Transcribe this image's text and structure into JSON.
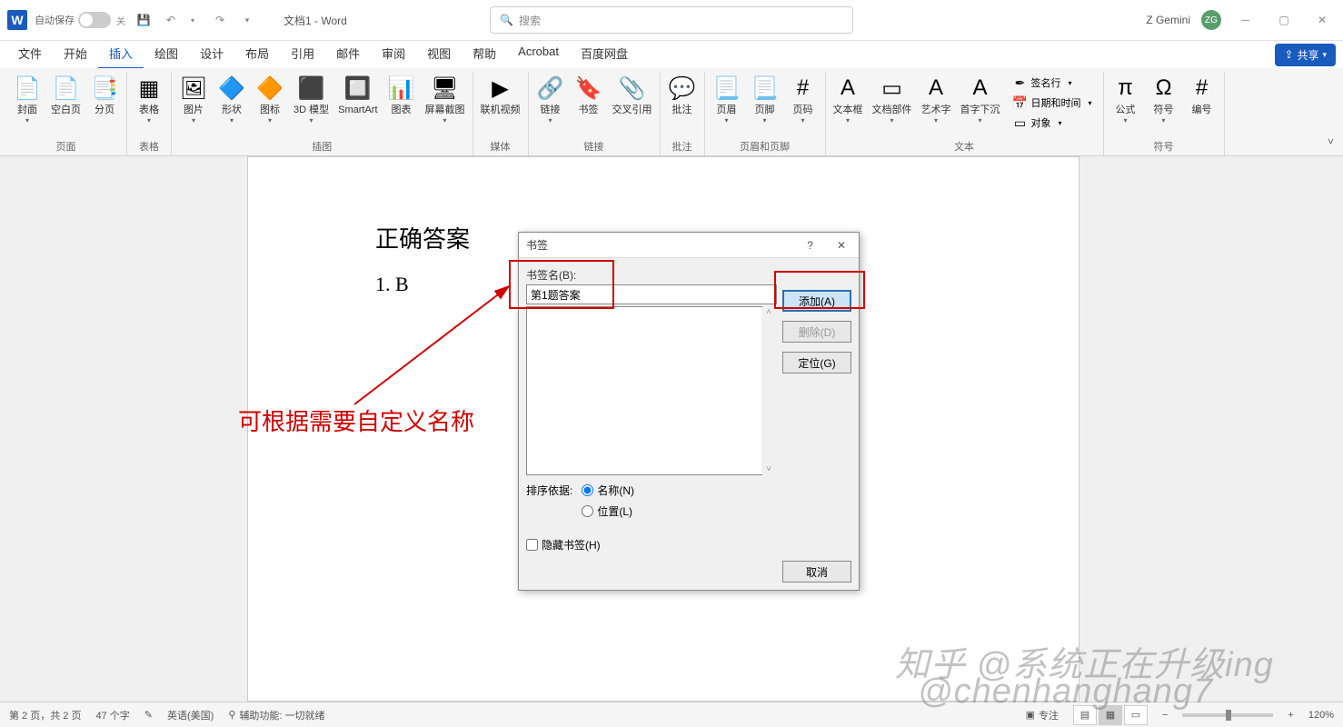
{
  "titlebar": {
    "autosave_label": "自动保存",
    "autosave_state": "关",
    "doc_title": "文档1 - Word",
    "search_placeholder": "搜索",
    "user_name": "Z Gemini",
    "user_initials": "ZG"
  },
  "tabs": {
    "items": [
      "文件",
      "开始",
      "插入",
      "绘图",
      "设计",
      "布局",
      "引用",
      "邮件",
      "审阅",
      "视图",
      "帮助",
      "Acrobat",
      "百度网盘"
    ],
    "active_index": 2,
    "share_label": "共享"
  },
  "ribbon": {
    "groups": [
      {
        "label": "页面",
        "items": [
          {
            "label": "封面",
            "icon": "📄",
            "caret": true
          },
          {
            "label": "空白页",
            "icon": "📄"
          },
          {
            "label": "分页",
            "icon": "📑"
          }
        ]
      },
      {
        "label": "表格",
        "items": [
          {
            "label": "表格",
            "icon": "▦",
            "caret": true
          }
        ]
      },
      {
        "label": "插图",
        "items": [
          {
            "label": "图片",
            "icon": "🖼",
            "caret": true
          },
          {
            "label": "形状",
            "icon": "🔷",
            "caret": true
          },
          {
            "label": "图标",
            "icon": "🔶",
            "caret": true
          },
          {
            "label": "3D 模型",
            "icon": "⬛",
            "caret": true
          },
          {
            "label": "SmartArt",
            "icon": "🔲"
          },
          {
            "label": "图表",
            "icon": "📊"
          },
          {
            "label": "屏幕截图",
            "icon": "🖥",
            "caret": true
          }
        ]
      },
      {
        "label": "媒体",
        "items": [
          {
            "label": "联机视频",
            "icon": "▶"
          }
        ]
      },
      {
        "label": "链接",
        "items": [
          {
            "label": "链接",
            "icon": "🔗",
            "caret": true
          },
          {
            "label": "书签",
            "icon": "🔖"
          },
          {
            "label": "交叉引用",
            "icon": "📎"
          }
        ]
      },
      {
        "label": "批注",
        "items": [
          {
            "label": "批注",
            "icon": "💬"
          }
        ]
      },
      {
        "label": "页眉和页脚",
        "items": [
          {
            "label": "页眉",
            "icon": "📃",
            "caret": true
          },
          {
            "label": "页脚",
            "icon": "📃",
            "caret": true
          },
          {
            "label": "页码",
            "icon": "#",
            "caret": true
          }
        ]
      },
      {
        "label": "文本",
        "items": [
          {
            "label": "文本框",
            "icon": "A",
            "caret": true
          },
          {
            "label": "文档部件",
            "icon": "▭",
            "caret": true
          },
          {
            "label": "艺术字",
            "icon": "A",
            "caret": true
          },
          {
            "label": "首字下沉",
            "icon": "A",
            "caret": true
          }
        ],
        "small": [
          {
            "label": "签名行",
            "icon": "✒"
          },
          {
            "label": "日期和时间",
            "icon": "📅"
          },
          {
            "label": "对象",
            "icon": "▭"
          }
        ]
      },
      {
        "label": "符号",
        "items": [
          {
            "label": "公式",
            "icon": "π",
            "caret": true
          },
          {
            "label": "符号",
            "icon": "Ω",
            "caret": true
          },
          {
            "label": "编号",
            "icon": "#"
          }
        ]
      }
    ]
  },
  "document": {
    "heading": "正确答案",
    "line1": "1. B"
  },
  "annotation": {
    "text": "可根据需要自定义名称"
  },
  "dialog": {
    "title": "书签",
    "name_label": "书签名(B):",
    "name_value": "第1题答案",
    "add_label": "添加(A)",
    "delete_label": "删除(D)",
    "goto_label": "定位(G)",
    "sort_label": "排序依据:",
    "sort_name": "名称(N)",
    "sort_loc": "位置(L)",
    "hidden_label": "隐藏书签(H)",
    "cancel_label": "取消"
  },
  "statusbar": {
    "page_info": "第 2 页，共 2 页",
    "word_count": "47 个字",
    "language": "英语(美国)",
    "accessibility": "辅助功能: 一切就绪",
    "focus": "专注",
    "zoom": "120%"
  },
  "watermarks": {
    "w1": "知乎 @系统正在升级ing",
    "w2": "@chenhanghang7"
  }
}
